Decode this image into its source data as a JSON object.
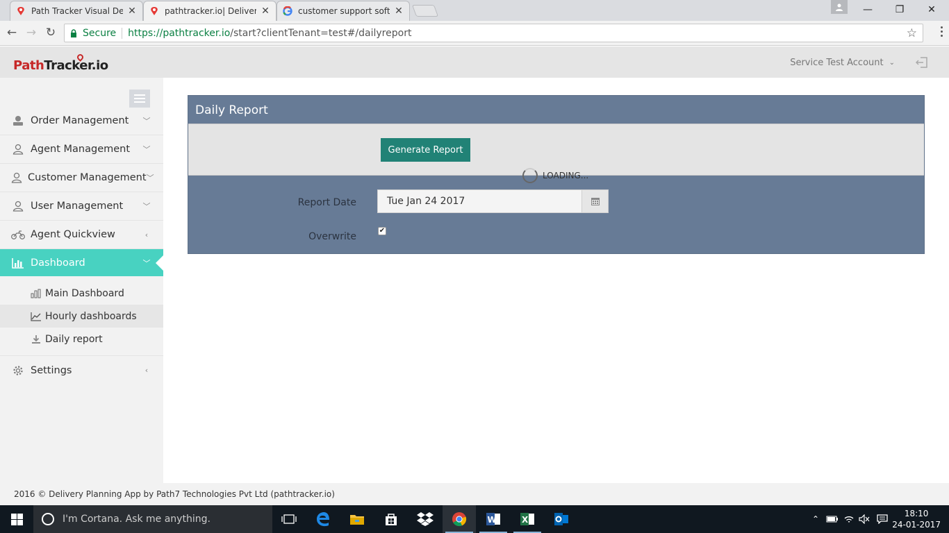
{
  "browser": {
    "tabs": [
      {
        "title": "Path Tracker Visual Delive",
        "icon": "pathtracker-favicon"
      },
      {
        "title": "pathtracker.io| Delivery P",
        "icon": "pathtracker-favicon"
      },
      {
        "title": "customer support softwa",
        "icon": "google-favicon"
      }
    ],
    "secure_label": "Secure",
    "url_host": "https://pathtracker.io",
    "url_path": "/start?clientTenant=test#/dailyreport"
  },
  "app": {
    "logo_part1": "Path",
    "logo_part2": "Tracker.io",
    "account_label": "Service Test Account"
  },
  "sidebar": {
    "items": [
      {
        "label": "Order Management",
        "icon": "order-icon",
        "chevron": "down"
      },
      {
        "label": "Agent Management",
        "icon": "agent-icon",
        "chevron": "down"
      },
      {
        "label": "Customer Management",
        "icon": "customer-icon",
        "chevron": "down"
      },
      {
        "label": "User Management",
        "icon": "user-icon",
        "chevron": "down"
      },
      {
        "label": "Agent Quickview",
        "icon": "motorbike-icon",
        "chevron": "left"
      },
      {
        "label": "Dashboard",
        "icon": "bar-chart-icon",
        "chevron": "down"
      },
      {
        "label": "Settings",
        "icon": "gear-icon",
        "chevron": "left"
      }
    ],
    "sub_items": [
      {
        "label": "Main Dashboard",
        "icon": "bar-chart-outline-icon"
      },
      {
        "label": "Hourly dashboards",
        "icon": "line-chart-icon"
      },
      {
        "label": "Daily report",
        "icon": "download-icon"
      }
    ]
  },
  "report": {
    "title": "Daily Report",
    "generate_button": "Generate Report",
    "loading_text": "LOADING...",
    "date_label": "Report Date",
    "date_value": "Tue Jan 24 2017",
    "overwrite_label": "Overwrite",
    "overwrite_checked": true
  },
  "footer": {
    "text": "2016 © Delivery Planning App by Path7 Technologies Pvt Ltd (pathtracker.io)"
  },
  "taskbar": {
    "cortana_placeholder": "I'm Cortana. Ask me anything.",
    "time": "18:10",
    "date": "24-01-2017"
  },
  "colors": {
    "accent": "#48d2c1",
    "panel": "#677b96",
    "button": "#218276",
    "brand_red": "#c62828"
  }
}
